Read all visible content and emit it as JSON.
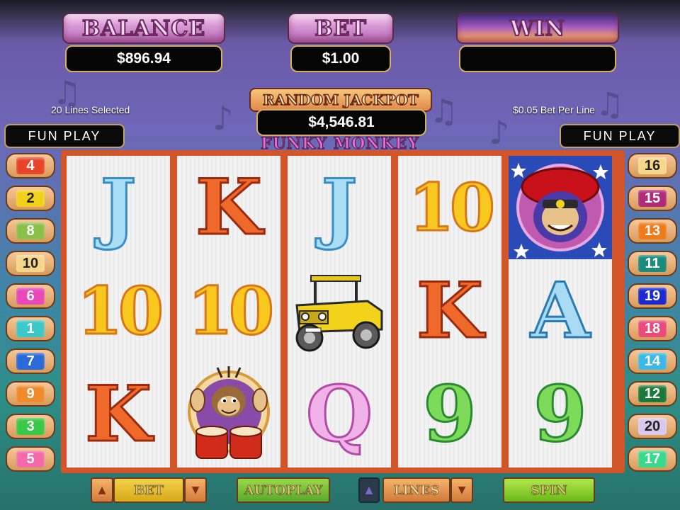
{
  "header": {
    "balance": {
      "label": "BALANCE",
      "value": "$896.94"
    },
    "bet": {
      "label": "BET",
      "value": "$1.00"
    },
    "win": {
      "label": "WIN",
      "value": ""
    },
    "jackpot": {
      "label": "RANDOM JACKPOT",
      "value": "$4,546.81"
    },
    "lines_selected": "20 Lines Selected",
    "bet_per_line": "$0.05 Bet Per Line",
    "game_title": "FUNKY MONKEY"
  },
  "mode": {
    "left": "FUN PLAY",
    "right": "FUN PLAY"
  },
  "left_lines": [
    {
      "num": "4",
      "color": "#e8442a"
    },
    {
      "num": "2",
      "color": "#f0d21a"
    },
    {
      "num": "8",
      "color": "#8ac04a"
    },
    {
      "num": "10",
      "color": "#f5d68a"
    },
    {
      "num": "6",
      "color": "#e848b8"
    },
    {
      "num": "1",
      "color": "#3ac8c8"
    },
    {
      "num": "7",
      "color": "#2a6ad8"
    },
    {
      "num": "9",
      "color": "#f08a2a"
    },
    {
      "num": "3",
      "color": "#3ac84a"
    },
    {
      "num": "5",
      "color": "#f46aa8"
    }
  ],
  "right_lines": [
    {
      "num": "16",
      "color": "#f5d68a"
    },
    {
      "num": "15",
      "color": "#b02a7a"
    },
    {
      "num": "13",
      "color": "#f07a1a"
    },
    {
      "num": "11",
      "color": "#1a8a7a"
    },
    {
      "num": "19",
      "color": "#1a2ad0"
    },
    {
      "num": "18",
      "color": "#e84a7a"
    },
    {
      "num": "14",
      "color": "#3ab8e8"
    },
    {
      "num": "12",
      "color": "#1a7a3a"
    },
    {
      "num": "20",
      "color": "#d8c8f0"
    },
    {
      "num": "17",
      "color": "#3ad88a"
    }
  ],
  "reels": [
    [
      "J",
      "10",
      "K"
    ],
    [
      "K",
      "10",
      "monkey-drummer"
    ],
    [
      "J",
      "jeep",
      "Q"
    ],
    [
      "10",
      "K",
      "9"
    ],
    [
      "monkey-wild",
      "A",
      "9"
    ]
  ],
  "controls": {
    "bet": "BET",
    "autoplay": "AUTOPLAY",
    "lines": "LINES",
    "spin": "SPIN"
  }
}
